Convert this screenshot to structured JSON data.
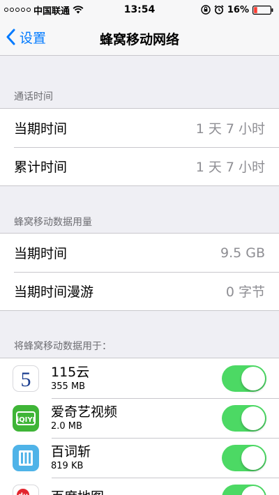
{
  "status_bar": {
    "carrier": "中国联通",
    "time": "13:54",
    "battery": "16%",
    "icons": [
      "signal-dots",
      "wifi-icon",
      "orientation-lock-icon",
      "alarm-icon",
      "battery-icon"
    ],
    "battery_color": "#ff3b30"
  },
  "nav": {
    "back_label": "设置",
    "title": "蜂窝移动网络",
    "accent_color": "#007aff"
  },
  "call_time": {
    "header": "通话时间",
    "rows": [
      {
        "label": "当期时间",
        "value": "1 天 7 小时"
      },
      {
        "label": "累计时间",
        "value": "1 天 7 小时"
      }
    ]
  },
  "data_usage": {
    "header": "蜂窝移动数据用量",
    "rows": [
      {
        "label": "当期时间",
        "value": "9.5 GB"
      },
      {
        "label": "当期时间漫游",
        "value": "0 字节"
      }
    ]
  },
  "apps": {
    "header": "将蜂窝移动数据用于：",
    "toggle_color": "#4cd964",
    "items": [
      {
        "name": "115云",
        "size": "355 MB",
        "icon": "115-cloud-icon",
        "enabled": true
      },
      {
        "name": "爱奇艺视频",
        "size": "2.0 MB",
        "icon": "iqiyi-icon",
        "enabled": true
      },
      {
        "name": "百词斩",
        "size": "819 KB",
        "icon": "baicizhan-icon",
        "enabled": true
      },
      {
        "name": "百度地图",
        "size": "",
        "icon": "baidu-map-icon",
        "enabled": true
      }
    ]
  }
}
